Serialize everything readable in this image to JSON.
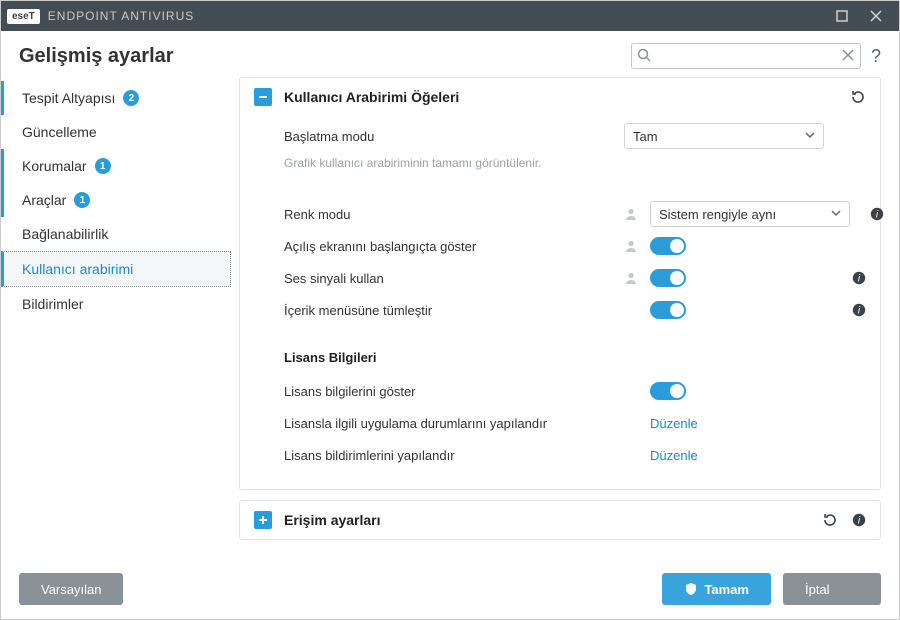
{
  "titlebar": {
    "brand": "eseT",
    "product": "ENDPOINT ANTIVIRUS"
  },
  "header": {
    "title": "Gelişmiş ayarlar",
    "search_placeholder": "",
    "help": "?"
  },
  "sidebar": {
    "items": [
      {
        "label": "Tespit Altyapısı",
        "badge": "2",
        "marked": true
      },
      {
        "label": "Güncelleme",
        "badge": "",
        "marked": false
      },
      {
        "label": "Korumalar",
        "badge": "1",
        "marked": true
      },
      {
        "label": "Araçlar",
        "badge": "1",
        "marked": true
      },
      {
        "label": "Bağlanabilirlik",
        "badge": "",
        "marked": false
      },
      {
        "label": "Kullanıcı arabirimi",
        "badge": "",
        "marked": false,
        "active": true
      },
      {
        "label": "Bildirimler",
        "badge": "",
        "marked": false
      }
    ]
  },
  "panel_ui": {
    "title": "Kullanıcı Arabirimi Öğeleri",
    "start_mode_label": "Başlatma modu",
    "start_mode_value": "Tam",
    "start_mode_hint": "Grafik kullanıcı arabiriminin tamamı görüntülenir.",
    "color_mode_label": "Renk modu",
    "color_mode_value": "Sistem rengiyle aynı",
    "splash_label": "Açılış ekranını başlangıçta göster",
    "sound_label": "Ses sinyali kullan",
    "context_label": "İçerik menüsüne tümleştir",
    "license_section": "Lisans Bilgileri",
    "license_show_label": "Lisans bilgilerini göster",
    "license_app_states_label": "Lisansla ilgili uygulama durumlarını yapılandır",
    "license_notif_label": "Lisans bildirimlerini yapılandır",
    "edit_link": "Düzenle"
  },
  "panel_access": {
    "title": "Erişim ayarları"
  },
  "footer": {
    "default": "Varsayılan",
    "ok": "Tamam",
    "cancel": "İptal"
  }
}
